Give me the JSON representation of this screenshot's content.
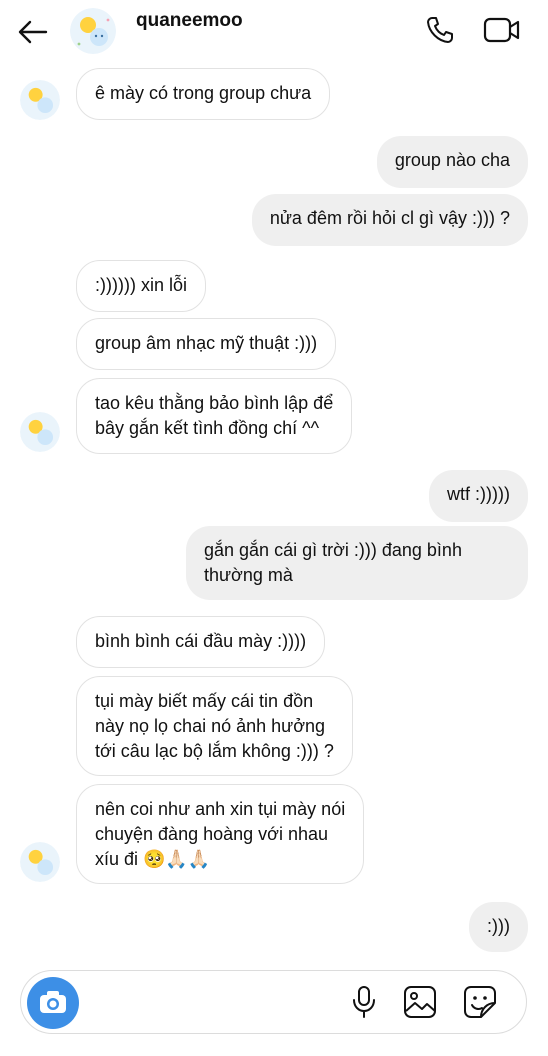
{
  "header": {
    "username": "quaneemoo"
  },
  "messages": [
    {
      "side": "in",
      "lines": [
        "ê mày có trong group chưa"
      ]
    },
    {
      "side": "out",
      "lines": [
        "group nào cha"
      ]
    },
    {
      "side": "out",
      "lines": [
        "nửa đêm rồi hỏi cl gì vậy :))) ?"
      ]
    },
    {
      "side": "in",
      "lines": [
        ":)))))) xin lỗi"
      ]
    },
    {
      "side": "in",
      "lines": [
        "group âm nhạc mỹ thuật :)))"
      ]
    },
    {
      "side": "in",
      "lines": [
        "tao kêu thằng bảo bình lập để",
        "bây gắn kết tình đồng chí ^^"
      ]
    },
    {
      "side": "out",
      "lines": [
        "wtf :)))))"
      ]
    },
    {
      "side": "out",
      "lines": [
        "gắn gắn cái gì trời :))) đang bình",
        "thường mà"
      ]
    },
    {
      "side": "in",
      "lines": [
        "bình bình cái đầu mày :))))"
      ]
    },
    {
      "side": "in",
      "lines": [
        "tụi mày biết mấy cái tin đồn",
        "này nọ lọ chai nó ảnh hưởng",
        "tới câu lạc bộ lắm không :))) ?"
      ]
    },
    {
      "side": "in",
      "lines": [
        "nên coi như anh xin tụi mày nói",
        "chuyện đàng hoàng với nhau",
        "xíu đi 🥺🙏🏻🙏🏻"
      ]
    },
    {
      "side": "out",
      "lines": [
        ":)))"
      ]
    }
  ],
  "icons": {
    "back": "arrow-left-icon",
    "call": "phone-icon",
    "video": "video-camera-icon",
    "camera": "camera-icon",
    "mic": "microphone-icon",
    "gallery": "image-gallery-icon",
    "sticker": "sticker-icon"
  },
  "colors": {
    "camera_button": "#3d8fe6",
    "out_bubble": "#efefef",
    "in_border": "#e2e2e2"
  }
}
